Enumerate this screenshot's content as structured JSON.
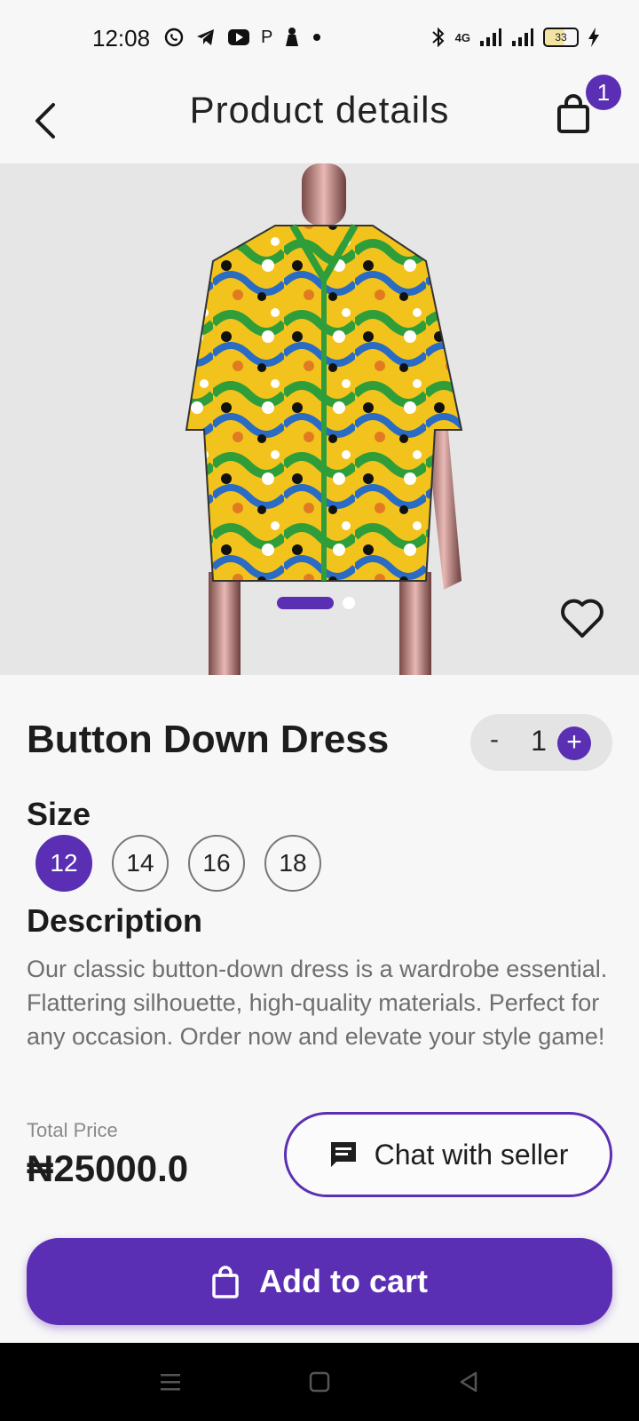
{
  "status": {
    "time": "12:08",
    "network": "4G",
    "battery": "33",
    "notif_icons": [
      "whatsapp-icon",
      "telegram-icon",
      "youtube-icon",
      "p-icon",
      "person-icon",
      "dot-icon"
    ]
  },
  "header": {
    "title": "Product details",
    "cart_count": "1"
  },
  "product": {
    "name": "Button Down Dress",
    "quantity": "1",
    "minus_label": "-",
    "plus_label": "+",
    "size_label": "Size",
    "sizes": [
      "12",
      "14",
      "16",
      "18"
    ],
    "selected_size": "12",
    "description_label": "Description",
    "description": "Our classic button-down dress is a wardrobe essential. Flattering silhouette, high-quality materials. Perfect for any occasion. Order now and elevate your style game!",
    "price_label": "Total Price",
    "price": "₦25000.0"
  },
  "actions": {
    "chat_label": "Chat with seller",
    "add_to_cart_label": "Add to cart"
  },
  "carousel": {
    "slides": 2,
    "active_index": 0
  },
  "colors": {
    "accent": "#5b2fb3",
    "background": "#f7f7f7"
  }
}
